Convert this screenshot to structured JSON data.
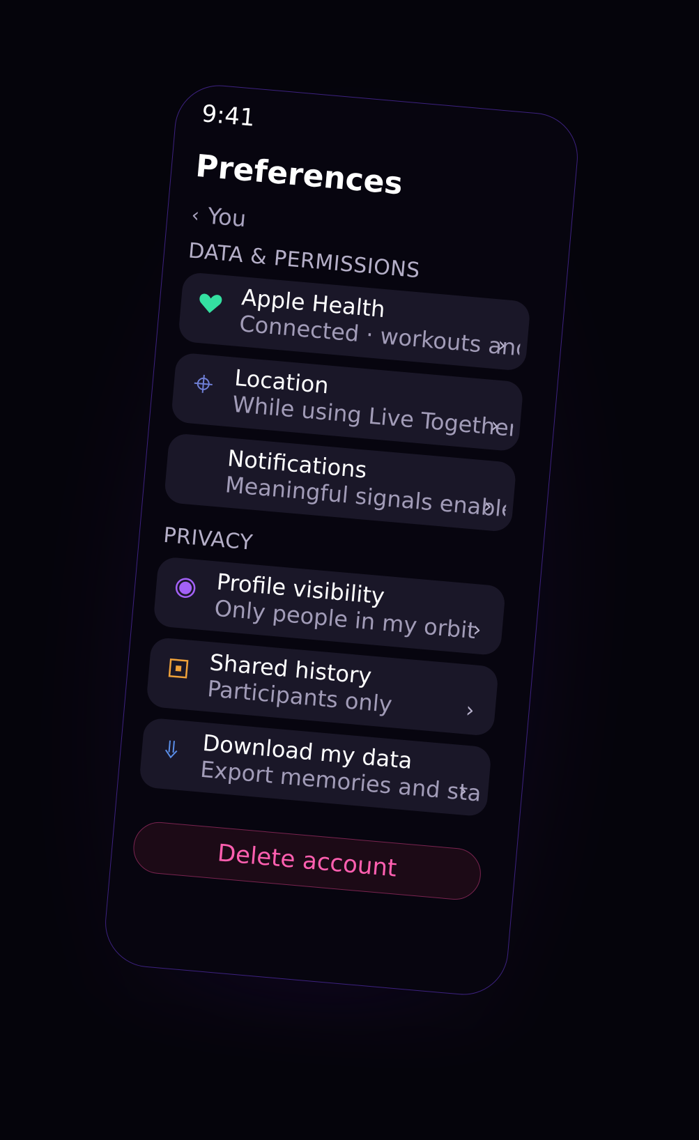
{
  "status_bar": {
    "time": "9:41"
  },
  "header": {
    "title": "Preferences",
    "back_label": "You",
    "back_chevron": "‹"
  },
  "sections": [
    {
      "label": "DATA & PERMISSIONS",
      "items": [
        {
          "icon": "heart-icon",
          "title": "Apple Health",
          "subtitle": "Connected · workouts and",
          "color": "#34e0a1"
        },
        {
          "icon": "crosshair-icon",
          "title": "Location",
          "subtitle": "While using Live Together",
          "color": "#6f7fd6"
        },
        {
          "icon": "bell-icon",
          "title": "Notifications",
          "subtitle": "Meaningful signals enabled",
          "color": "#1a1728"
        }
      ]
    },
    {
      "label": "PRIVACY",
      "items": [
        {
          "icon": "circle-dot-icon",
          "title": "Profile visibility",
          "subtitle": "Only people in my orbit",
          "color": "#a361f7"
        },
        {
          "icon": "square-dot-icon",
          "title": "Shared history",
          "subtitle": "Participants only",
          "color": "#f0a23a"
        },
        {
          "icon": "download-icon",
          "title": "Download my data",
          "subtitle": "Export memories and stats",
          "color": "#5a8ee8"
        }
      ]
    }
  ],
  "chevron": "›",
  "delete_button": {
    "label": "Delete account",
    "color": "#ff5fb0"
  }
}
